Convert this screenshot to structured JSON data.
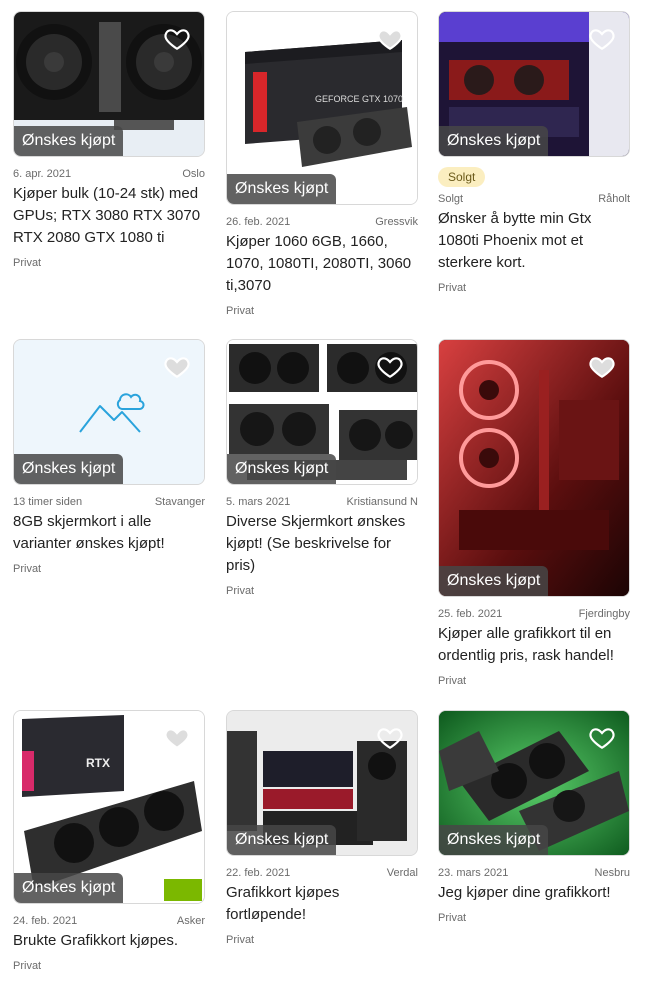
{
  "listings": [
    {
      "badge": "Ønskes kjøpt",
      "date": "6. apr. 2021",
      "location": "Oslo",
      "title": "Kjøper bulk (10-24 stk) med GPUs; RTX 3080 RTX 3070 RTX 2080 GTX 1080 ti",
      "seller": "Privat",
      "sold": null
    },
    {
      "badge": "Ønskes kjøpt",
      "date": "26. feb. 2021",
      "location": "Gressvik",
      "title": "Kjøper 1060 6GB, 1660, 1070, 1080TI, 2080TI, 3060 ti,3070",
      "seller": "Privat",
      "sold": null
    },
    {
      "badge": "Ønskes kjøpt",
      "date": "Solgt",
      "location": "Råholt",
      "title": "Ønsker å bytte min Gtx 1080ti Phoenix mot et sterkere kort.",
      "seller": "Privat",
      "sold": "Solgt"
    },
    {
      "badge": "Ønskes kjøpt",
      "date": "13 timer siden",
      "location": "Stavanger",
      "title": "8GB skjermkort i alle varianter ønskes kjøpt!",
      "seller": "Privat",
      "sold": null
    },
    {
      "badge": "Ønskes kjøpt",
      "date": "5. mars 2021",
      "location": "Kristiansund N",
      "title": "Diverse Skjermkort ønskes kjøpt! (Se beskrivelse for pris)",
      "seller": "Privat",
      "sold": null
    },
    {
      "badge": "Ønskes kjøpt",
      "date": "25. feb. 2021",
      "location": "Fjerdingby",
      "title": "Kjøper alle grafikkort til en ordentlig pris, rask handel!",
      "seller": "Privat",
      "sold": null
    },
    {
      "badge": "Ønskes kjøpt",
      "date": "24. feb. 2021",
      "location": "Asker",
      "title": "Brukte Grafikkort kjøpes.",
      "seller": "Privat",
      "sold": null
    },
    {
      "badge": "Ønskes kjøpt",
      "date": "22. feb. 2021",
      "location": "Verdal",
      "title": "Grafikkort kjøpes fortløpende!",
      "seller": "Privat",
      "sold": null
    },
    {
      "badge": "Ønskes kjøpt",
      "date": "23. mars 2021",
      "location": "Nesbru",
      "title": "Jeg kjøper dine grafikkort!",
      "seller": "Privat",
      "sold": null
    }
  ],
  "image_texts": {
    "rtx_box": "RTX",
    "gtx_box": "GEFORCE GTX 1070"
  },
  "colors": {
    "badge_bg": "#464646",
    "sold_bg": "#fbeec0",
    "placeholder_bg": "#eef6fc",
    "placeholder_icon": "#2aa3dc"
  }
}
